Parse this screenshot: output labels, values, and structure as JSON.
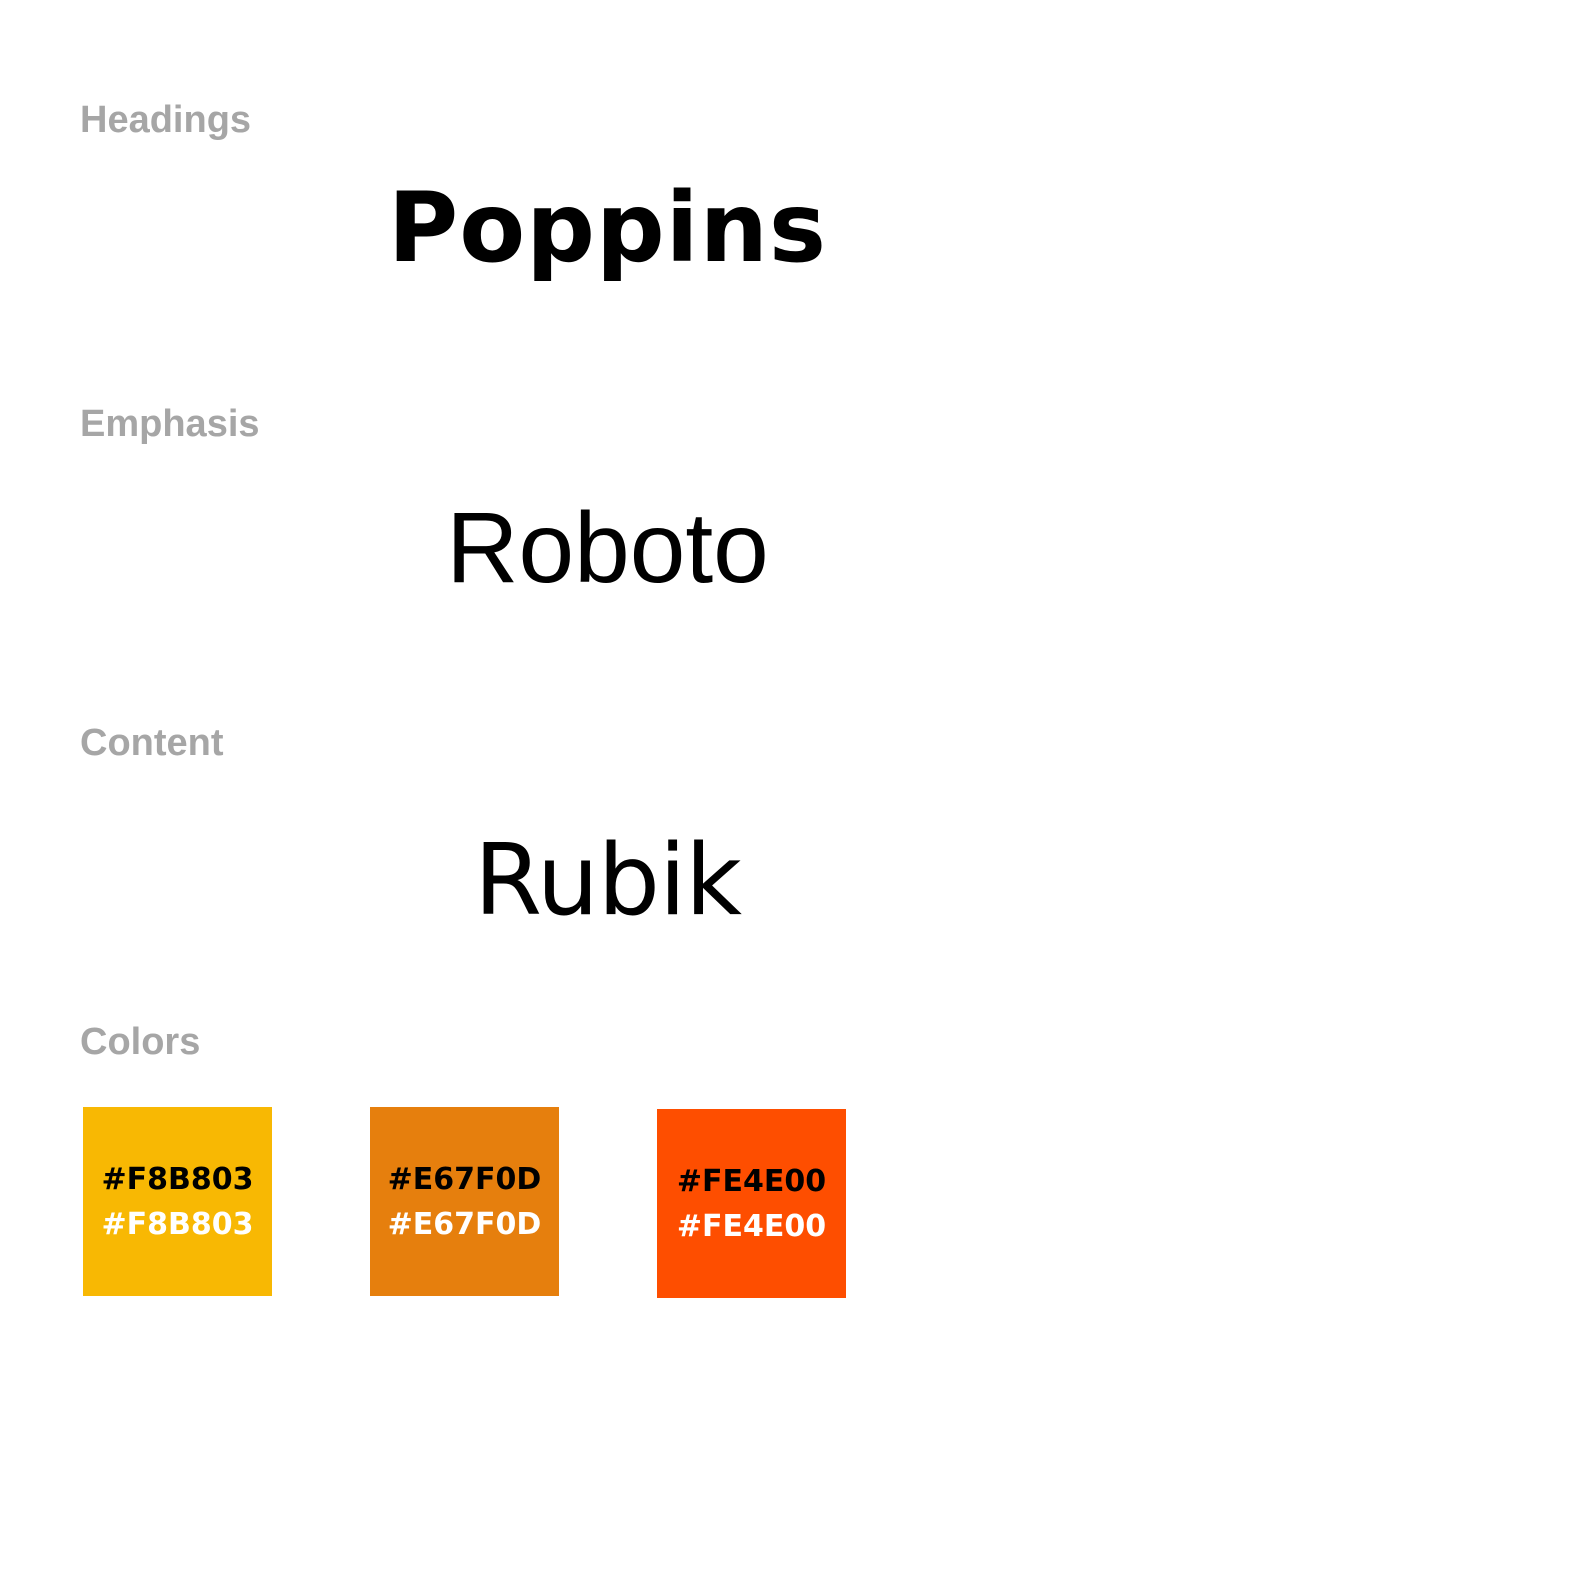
{
  "sections": {
    "headings": {
      "label": "Headings",
      "font_name": "Poppins"
    },
    "emphasis": {
      "label": "Emphasis",
      "font_name": "Roboto"
    },
    "content": {
      "label": "Content",
      "font_name": "Rubik"
    },
    "colors": {
      "label": "Colors"
    }
  },
  "palette": [
    {
      "hex": "#F8B803",
      "dark_label": "#F8B803",
      "light_label": "#F8B803"
    },
    {
      "hex": "#E67F0D",
      "dark_label": "#E67F0D",
      "light_label": "#E67F0D"
    },
    {
      "hex": "#FE4E00",
      "dark_label": "#FE4E00",
      "light_label": "#FE4E00"
    }
  ],
  "style_colors": {
    "label_gray": "#a6a6a6",
    "text_dark": "#000000",
    "text_light": "#ffffff",
    "background": "#ffffff"
  }
}
